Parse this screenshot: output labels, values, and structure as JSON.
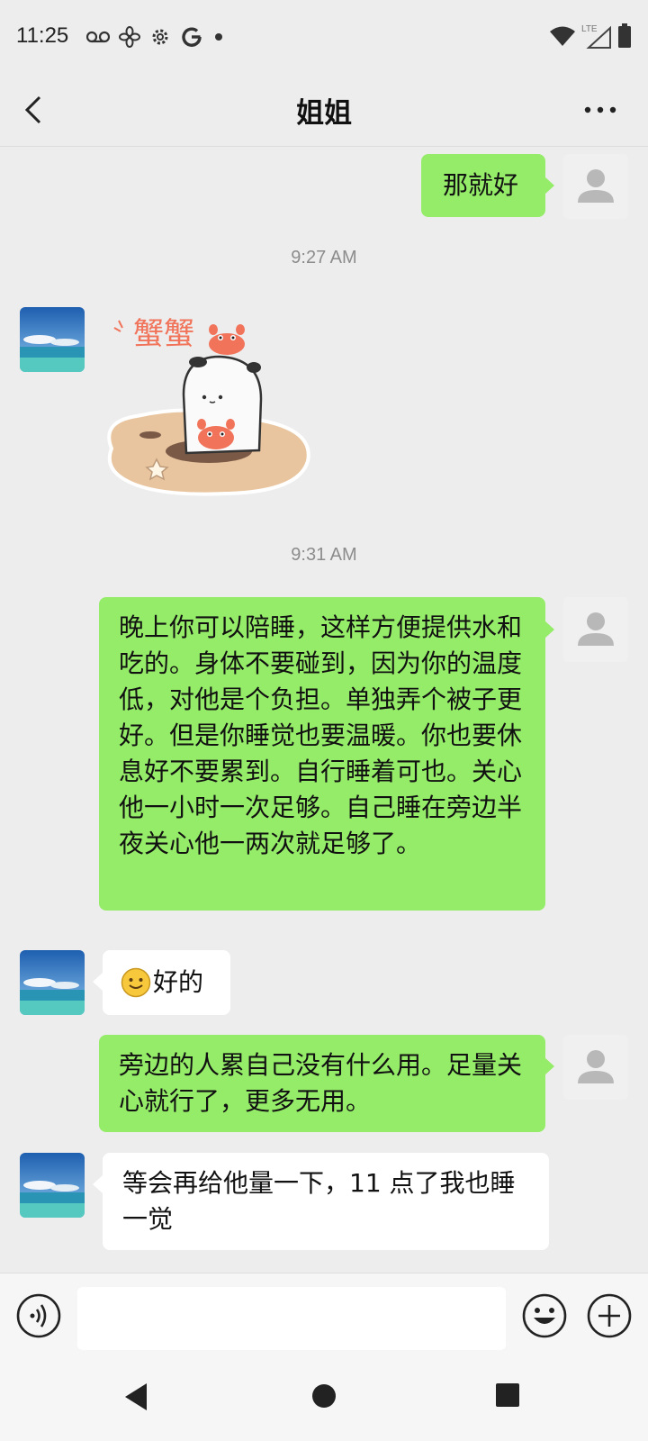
{
  "status_bar": {
    "time": "11:25",
    "left_icons": [
      "voicemail-icon",
      "fan-icon",
      "settings-icon",
      "google-icon",
      "dot-icon"
    ],
    "right_icons": [
      "wifi-icon",
      "lte-signal-icon",
      "battery-icon"
    ],
    "network_label": "LTE"
  },
  "header": {
    "title": "姐姐",
    "back_icon": "chevron-left-icon",
    "more_icon": "more-horizontal-icon"
  },
  "messages": [
    {
      "side": "me",
      "type": "text",
      "text": "那就好"
    },
    {
      "type": "timestamp",
      "text": "9:27 AM"
    },
    {
      "side": "them",
      "type": "sticker",
      "sticker_text": "蟹蟹",
      "sticker_desc": "white ghost with crabs on sand sticker"
    },
    {
      "type": "timestamp",
      "text": "9:31 AM"
    },
    {
      "side": "me",
      "type": "text",
      "text": "晚上你可以陪睡，这样方便提供水和吃的。身体不要碰到，因为你的温度低，对他是个负担。单独弄个被子更好。但是你睡觉也要温暖。你也要休息好不要累到。自行睡着可也。关心他一小时一次足够。自己睡在旁边半夜关心他一两次就足够了。"
    },
    {
      "side": "them",
      "type": "text",
      "emoji": "smile-emoji",
      "text": "好的"
    },
    {
      "side": "me",
      "type": "text",
      "text": "旁边的人累自己没有什么用。足量关心就行了，更多无用。"
    },
    {
      "side": "them",
      "type": "text",
      "text": "等会再给他量一下，11 点了我也睡一觉"
    }
  ],
  "input_bar": {
    "voice_icon": "voice-input-icon",
    "placeholder": "",
    "emoji_icon": "emoji-icon",
    "plus_icon": "plus-circle-icon"
  },
  "system_nav": [
    "back-triangle-icon",
    "home-circle-icon",
    "recents-square-icon"
  ],
  "colors": {
    "background": "#ededed",
    "my_bubble": "#95ec69",
    "their_bubble": "#ffffff",
    "timestamp_text": "#8c8c8c"
  }
}
